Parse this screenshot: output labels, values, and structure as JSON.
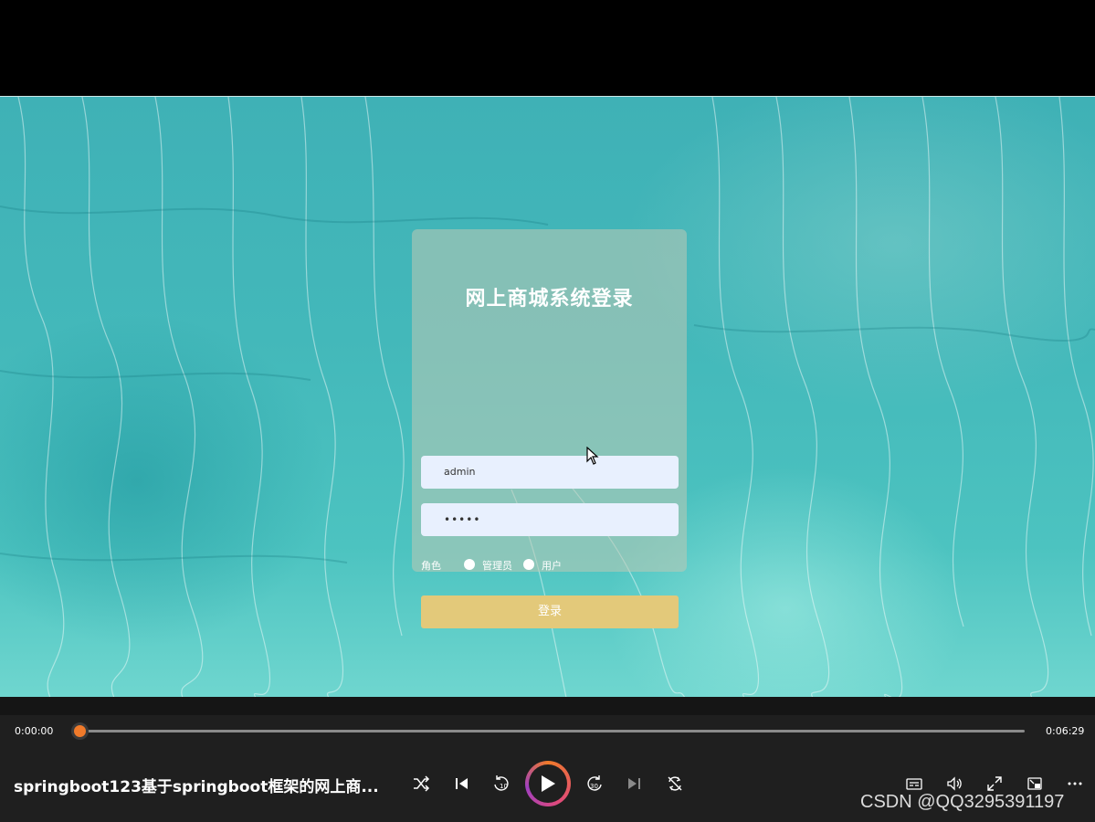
{
  "login": {
    "title": "网上商城系统登录",
    "username_value": "admin",
    "password_value": "•••••",
    "role_label": "角色",
    "role_options": [
      "管理员",
      "用户"
    ],
    "login_button": "登录"
  },
  "player": {
    "time_current": "0:00:00",
    "time_total": "0:06:29",
    "progress_fraction": 0.0,
    "title": "springboot123基于springboot框架的网上商...",
    "accent_color": "#f07a2a",
    "controls": [
      "shuffle-icon",
      "previous-icon",
      "rewind-10-icon",
      "play-icon",
      "forward-30-icon",
      "next-icon",
      "repeat-icon",
      "captions-icon",
      "volume-icon",
      "fullscreen-icon",
      "miniplayer-icon",
      "more-icon"
    ]
  },
  "watermark": "CSDN @QQ3295391197"
}
